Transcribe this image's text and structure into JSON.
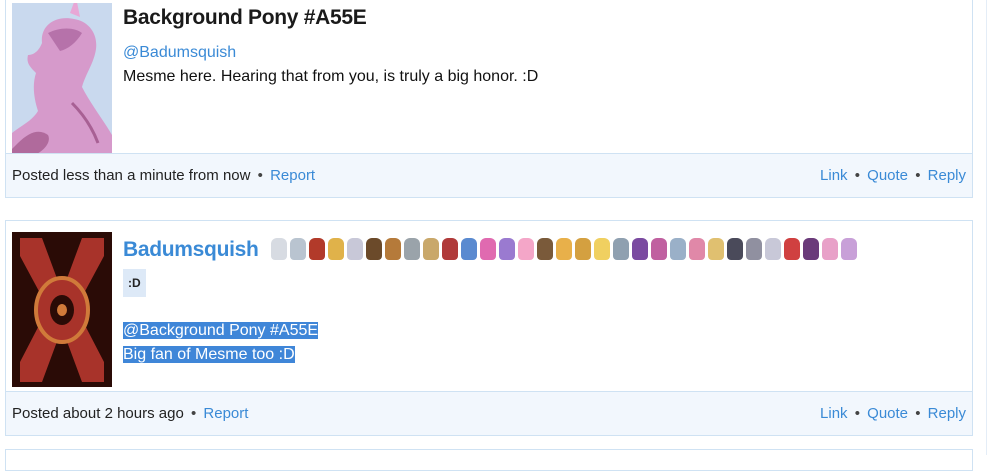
{
  "posts": [
    {
      "author": "Background Pony #A55E",
      "mention": "@Badumsquish",
      "body": "Mesme here. Hearing that from you, is truly a big honor. :D",
      "footer": {
        "posted": "Posted less than a minute from now",
        "report": "Report",
        "link": "Link",
        "quote": "Quote",
        "reply": "Reply"
      }
    },
    {
      "author": "Badumsquish",
      "tag": ":D",
      "mention": "@Background Pony #A55E",
      "body": "Big fan of Mesme too :D",
      "footer": {
        "posted": "Posted about 2 hours ago",
        "report": "Report",
        "link": "Link",
        "quote": "Quote",
        "reply": "Reply"
      }
    }
  ],
  "separator": "•",
  "colors": {
    "link": "#3a8ad6",
    "footer_bg": "#f2f7fd",
    "border": "#cfe2f3",
    "selection": "#3f86d8"
  },
  "badge_colors": [
    "#d7dbe2",
    "#b9c4d0",
    "#b23a2a",
    "#e0b24a",
    "#c8c8d8",
    "#6b4a2a",
    "#b57a3a",
    "#9aa3aa",
    "#c9a86a",
    "#b03a3a",
    "#5a8ad0",
    "#e06ab0",
    "#9a7ad0",
    "#f4a6c8",
    "#7a5a3a",
    "#e8b04a",
    "#d4a040",
    "#f0d060",
    "#8fa0b0",
    "#7a4aa0",
    "#c060a0",
    "#9ab0c8",
    "#e088a8",
    "#e0c070",
    "#4a4a5a",
    "#9090a0",
    "#c8c8d8",
    "#d04040",
    "#6a3a7a",
    "#e8a0c8",
    "#c8a0d8"
  ]
}
